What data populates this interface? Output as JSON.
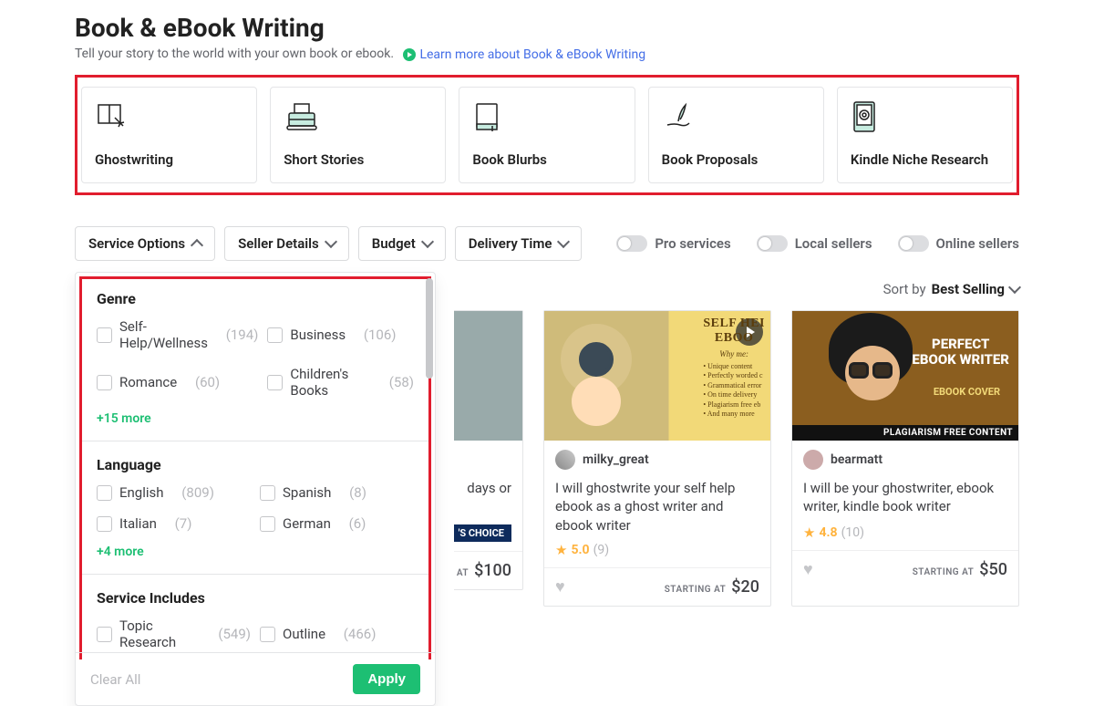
{
  "header": {
    "title": "Book & eBook Writing",
    "subtitle": "Tell your story to the world with your own book or ebook.",
    "learn_more": "Learn more about Book & eBook Writing"
  },
  "categories": [
    {
      "label": "Ghostwriting"
    },
    {
      "label": "Short Stories"
    },
    {
      "label": "Book Blurbs"
    },
    {
      "label": "Book Proposals"
    },
    {
      "label": "Kindle Niche Research"
    }
  ],
  "filters": {
    "service_options": "Service Options",
    "seller_details": "Seller Details",
    "budget": "Budget",
    "delivery_time": "Delivery Time"
  },
  "toggles": {
    "pro": "Pro services",
    "local": "Local sellers",
    "online": "Online sellers"
  },
  "sort": {
    "label": "Sort by",
    "value": "Best Selling"
  },
  "panel": {
    "genre": {
      "title": "Genre",
      "items": [
        {
          "label": "Self-Help/Wellness",
          "count": "(194)"
        },
        {
          "label": "Business",
          "count": "(106)"
        },
        {
          "label": "Romance",
          "count": "(60)"
        },
        {
          "label": "Children's Books",
          "count": "(58)"
        }
      ],
      "more": "+15 more"
    },
    "language": {
      "title": "Language",
      "items": [
        {
          "label": "English",
          "count": "(809)"
        },
        {
          "label": "Spanish",
          "count": "(8)"
        },
        {
          "label": "Italian",
          "count": "(7)"
        },
        {
          "label": "German",
          "count": "(6)"
        }
      ],
      "more": "+4 more"
    },
    "includes": {
      "title": "Service Includes",
      "items": [
        {
          "label": "Topic Research",
          "count": "(549)"
        },
        {
          "label": "Outline",
          "count": "(466)"
        }
      ]
    },
    "clear": "Clear All",
    "apply": "Apply"
  },
  "partial_card": {
    "title_tail": "days or",
    "badge": "'S CHOICE",
    "start": "STARTING AT",
    "price": "$100"
  },
  "cards": [
    {
      "seller": "milky_great",
      "title": "I will ghostwrite your self help ebook as a ghost writer and ebook writer",
      "rating": "5.0",
      "reviews": "(9)",
      "start": "STARTING AT",
      "price": "$20",
      "art_title": "SELF HEI",
      "art_sub": "EBOO",
      "art_why": "Why me:",
      "art_lines": "• Unique content\n• Perfectly worded c\n• Grammatical error\n• On time delivery\n• Plagiarism free eb\n• And many more"
    },
    {
      "seller": "bearmatt",
      "title": "I will be your ghostwriter, ebook writer, kindle book writer",
      "rating": "4.8",
      "reviews": "(10)",
      "start": "STARTING AT",
      "price": "$50",
      "art_t1": "PERFECT\nEBOOK WRITER",
      "art_t2": "EBOOK COVER",
      "art_strip": "PLAGIARISM FREE CONTENT"
    }
  ]
}
